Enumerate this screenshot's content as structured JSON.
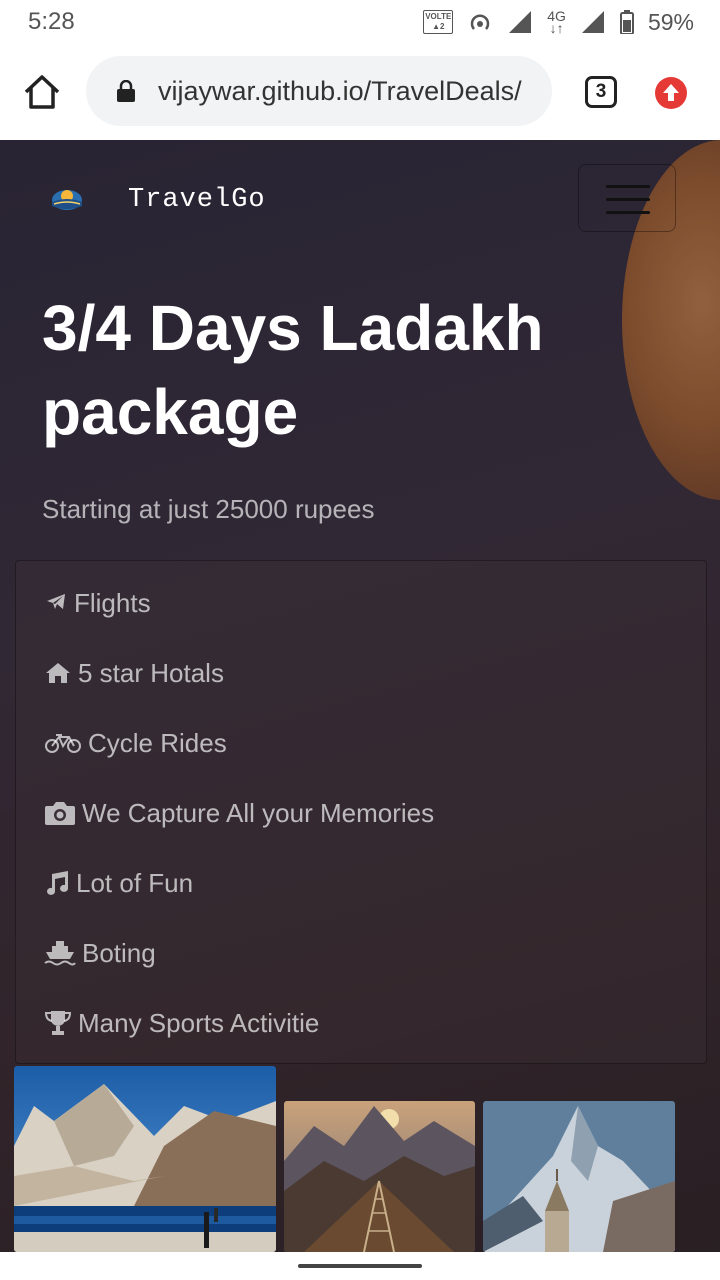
{
  "status_bar": {
    "time": "5:28",
    "volte_label": "VOLTE",
    "network": "4G",
    "battery": "59%"
  },
  "browser": {
    "url": "vijaywar.github.io/TravelDeals/",
    "tab_count": "3"
  },
  "header": {
    "brand": "TravelGo"
  },
  "hero": {
    "title": "3/4 Days Ladakh package",
    "subtitle": "Starting at just 25000 rupees"
  },
  "features": [
    {
      "icon": "plane-icon",
      "label": "Flights"
    },
    {
      "icon": "home-icon",
      "label": "5 star Hotals"
    },
    {
      "icon": "bicycle-icon",
      "label": "Cycle Rides"
    },
    {
      "icon": "camera-icon",
      "label": "We Capture All your Memories"
    },
    {
      "icon": "music-icon",
      "label": "Lot of Fun"
    },
    {
      "icon": "ship-icon",
      "label": "Boting"
    },
    {
      "icon": "trophy-icon",
      "label": "Many Sports Activitie"
    }
  ],
  "colors": {
    "accent_update": "#e53935",
    "hero_text": "#ffffff"
  }
}
